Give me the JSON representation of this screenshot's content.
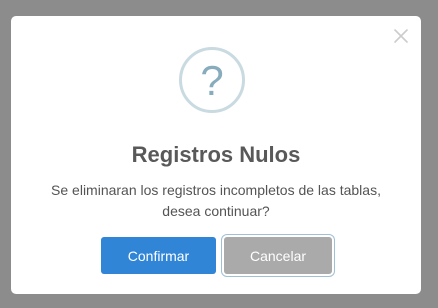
{
  "dialog": {
    "icon": "question-icon",
    "icon_glyph": "?",
    "title": "Registros Nulos",
    "message": "Se eliminaran los registros incompletos de las tablas, desea continuar?",
    "confirm_label": "Confirmar",
    "cancel_label": "Cancelar",
    "close_icon": "close-icon"
  },
  "colors": {
    "overlay": "#8c8c8c",
    "confirm_button": "#3085d6",
    "cancel_button": "#aaaaaa",
    "icon_border": "#c9dae1",
    "icon_glyph": "#87adbd",
    "title": "#595959"
  }
}
